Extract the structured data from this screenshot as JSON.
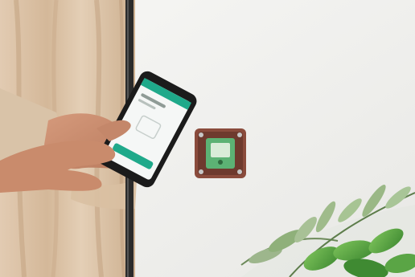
{
  "scene": {
    "wall_color": "#f1f1ef",
    "curtain_color": "#d8c2a8",
    "pole_color": "#2a2a2a",
    "phone_accent_color": "#1fa98a",
    "device_frame_color": "#8a4b3c",
    "device_module_color": "#4caf6a",
    "plant_color": "#4f9a3a"
  }
}
